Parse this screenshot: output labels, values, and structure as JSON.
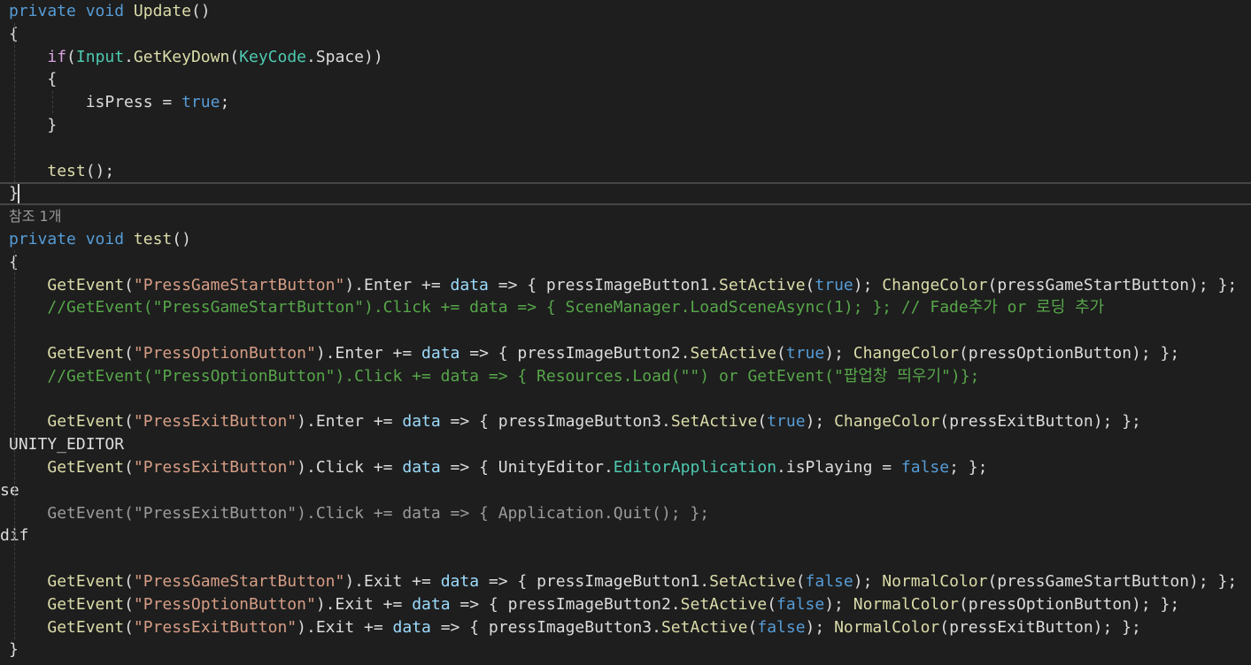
{
  "lines": [
    {
      "kind": "code",
      "tokens": [
        {
          "t": "private",
          "c": "kw"
        },
        {
          "t": " "
        },
        {
          "t": "void",
          "c": "kw"
        },
        {
          "t": " "
        },
        {
          "t": "Update",
          "c": "method"
        },
        {
          "t": "()"
        }
      ]
    },
    {
      "kind": "code",
      "tokens": [
        {
          "t": "{"
        }
      ]
    },
    {
      "kind": "code",
      "tokens": [
        {
          "t": "    "
        },
        {
          "t": "if",
          "c": "ctrl"
        },
        {
          "t": "("
        },
        {
          "t": "Input",
          "c": "type"
        },
        {
          "t": "."
        },
        {
          "t": "GetKeyDown",
          "c": "method"
        },
        {
          "t": "("
        },
        {
          "t": "KeyCode",
          "c": "type"
        },
        {
          "t": ".Space))"
        }
      ]
    },
    {
      "kind": "code",
      "tokens": [
        {
          "t": "    {"
        }
      ]
    },
    {
      "kind": "code",
      "tokens": [
        {
          "t": "        isPress = "
        },
        {
          "t": "true",
          "c": "kw"
        },
        {
          "t": ";"
        }
      ]
    },
    {
      "kind": "code",
      "tokens": [
        {
          "t": "    }"
        }
      ]
    },
    {
      "kind": "code",
      "tokens": []
    },
    {
      "kind": "code",
      "tokens": [
        {
          "t": "    "
        },
        {
          "t": "test",
          "c": "method"
        },
        {
          "t": "();"
        }
      ]
    },
    {
      "kind": "code",
      "current": true,
      "tokens": [
        {
          "t": "}"
        }
      ]
    },
    {
      "kind": "codelens",
      "text": "참조 1개"
    },
    {
      "kind": "code",
      "tokens": [
        {
          "t": "private",
          "c": "kw"
        },
        {
          "t": " "
        },
        {
          "t": "void",
          "c": "kw"
        },
        {
          "t": " "
        },
        {
          "t": "test",
          "c": "method"
        },
        {
          "t": "()"
        }
      ]
    },
    {
      "kind": "code",
      "tokens": [
        {
          "t": "{"
        }
      ]
    },
    {
      "kind": "code",
      "tokens": [
        {
          "t": "    "
        },
        {
          "t": "GetEvent",
          "c": "method"
        },
        {
          "t": "("
        },
        {
          "t": "\"PressGameStartButton\"",
          "c": "str"
        },
        {
          "t": ").Enter += "
        },
        {
          "t": "data",
          "c": "param"
        },
        {
          "t": " => { pressImageButton1."
        },
        {
          "t": "SetActive",
          "c": "method"
        },
        {
          "t": "("
        },
        {
          "t": "true",
          "c": "kw"
        },
        {
          "t": "); "
        },
        {
          "t": "ChangeColor",
          "c": "method"
        },
        {
          "t": "(pressGameStartButton); };"
        }
      ]
    },
    {
      "kind": "code",
      "tokens": [
        {
          "t": "    "
        },
        {
          "t": "//GetEvent(\"PressGameStartButton\").Click += data => { SceneManager.LoadSceneAsync(1); }; // Fade추가 or 로딩 추가",
          "c": "comment"
        }
      ]
    },
    {
      "kind": "code",
      "tokens": []
    },
    {
      "kind": "code",
      "tokens": [
        {
          "t": "    "
        },
        {
          "t": "GetEvent",
          "c": "method"
        },
        {
          "t": "("
        },
        {
          "t": "\"PressOptionButton\"",
          "c": "str"
        },
        {
          "t": ").Enter += "
        },
        {
          "t": "data",
          "c": "param"
        },
        {
          "t": " => { pressImageButton2."
        },
        {
          "t": "SetActive",
          "c": "method"
        },
        {
          "t": "("
        },
        {
          "t": "true",
          "c": "kw"
        },
        {
          "t": "); "
        },
        {
          "t": "ChangeColor",
          "c": "method"
        },
        {
          "t": "(pressOptionButton); };"
        }
      ]
    },
    {
      "kind": "code",
      "tokens": [
        {
          "t": "    "
        },
        {
          "t": "//GetEvent(\"PressOptionButton\").Click += data => { Resources.Load(\"\") or GetEvent(\"팝업창 띄우기\")};",
          "c": "comment"
        }
      ]
    },
    {
      "kind": "code",
      "tokens": []
    },
    {
      "kind": "code",
      "tokens": [
        {
          "t": "    "
        },
        {
          "t": "GetEvent",
          "c": "method"
        },
        {
          "t": "("
        },
        {
          "t": "\"PressExitButton\"",
          "c": "str"
        },
        {
          "t": ").Enter += "
        },
        {
          "t": "data",
          "c": "param"
        },
        {
          "t": " => { pressImageButton3."
        },
        {
          "t": "SetActive",
          "c": "method"
        },
        {
          "t": "("
        },
        {
          "t": "true",
          "c": "kw"
        },
        {
          "t": "); "
        },
        {
          "t": "ChangeColor",
          "c": "method"
        },
        {
          "t": "(pressExitButton); };"
        }
      ]
    },
    {
      "kind": "code",
      "tokens": [
        {
          "t": "UNITY_EDITOR"
        }
      ]
    },
    {
      "kind": "code",
      "tokens": [
        {
          "t": "    "
        },
        {
          "t": "GetEvent",
          "c": "method"
        },
        {
          "t": "("
        },
        {
          "t": "\"PressExitButton\"",
          "c": "str"
        },
        {
          "t": ").Click += "
        },
        {
          "t": "data",
          "c": "param"
        },
        {
          "t": " => { UnityEditor."
        },
        {
          "t": "EditorApplication",
          "c": "type"
        },
        {
          "t": ".isPlaying = "
        },
        {
          "t": "false",
          "c": "kw"
        },
        {
          "t": "; };"
        }
      ]
    },
    {
      "kind": "code",
      "tokens": [
        {
          "t": "se"
        }
      ],
      "shift": -10
    },
    {
      "kind": "code",
      "tokens": [
        {
          "t": "    "
        },
        {
          "t": "GetEvent(",
          "c": "dim"
        },
        {
          "t": "\"PressExitButton\"",
          "c": "dimstr"
        },
        {
          "t": ").Click += data => { Application.Quit(); };",
          "c": "dim"
        }
      ]
    },
    {
      "kind": "code",
      "tokens": [
        {
          "t": "dif"
        }
      ],
      "shift": -10
    },
    {
      "kind": "code",
      "tokens": []
    },
    {
      "kind": "code",
      "tokens": [
        {
          "t": "    "
        },
        {
          "t": "GetEvent",
          "c": "method"
        },
        {
          "t": "("
        },
        {
          "t": "\"PressGameStartButton\"",
          "c": "str"
        },
        {
          "t": ").Exit += "
        },
        {
          "t": "data",
          "c": "param"
        },
        {
          "t": " => { pressImageButton1."
        },
        {
          "t": "SetActive",
          "c": "method"
        },
        {
          "t": "("
        },
        {
          "t": "false",
          "c": "kw"
        },
        {
          "t": "); "
        },
        {
          "t": "NormalColor",
          "c": "method"
        },
        {
          "t": "(pressGameStartButton); };"
        }
      ]
    },
    {
      "kind": "code",
      "tokens": [
        {
          "t": "    "
        },
        {
          "t": "GetEvent",
          "c": "method"
        },
        {
          "t": "("
        },
        {
          "t": "\"PressOptionButton\"",
          "c": "str"
        },
        {
          "t": ").Exit += "
        },
        {
          "t": "data",
          "c": "param"
        },
        {
          "t": " => { pressImageButton2."
        },
        {
          "t": "SetActive",
          "c": "method"
        },
        {
          "t": "("
        },
        {
          "t": "false",
          "c": "kw"
        },
        {
          "t": "); "
        },
        {
          "t": "NormalColor",
          "c": "method"
        },
        {
          "t": "(pressOptionButton); };"
        }
      ]
    },
    {
      "kind": "code",
      "tokens": [
        {
          "t": "    "
        },
        {
          "t": "GetEvent",
          "c": "method"
        },
        {
          "t": "("
        },
        {
          "t": "\"PressExitButton\"",
          "c": "str"
        },
        {
          "t": ").Exit += "
        },
        {
          "t": "data",
          "c": "param"
        },
        {
          "t": " => { pressImageButton3."
        },
        {
          "t": "SetActive",
          "c": "method"
        },
        {
          "t": "("
        },
        {
          "t": "false",
          "c": "kw"
        },
        {
          "t": "); "
        },
        {
          "t": "NormalColor",
          "c": "method"
        },
        {
          "t": "(pressExitButton); };"
        }
      ]
    },
    {
      "kind": "code",
      "tokens": [
        {
          "t": "}"
        }
      ]
    }
  ]
}
